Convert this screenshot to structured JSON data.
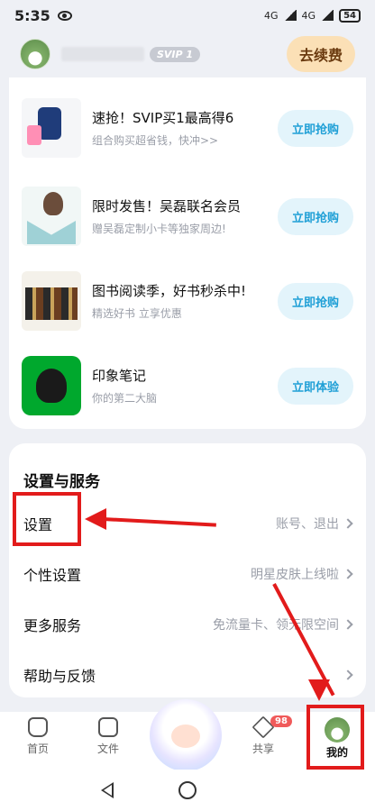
{
  "status_bar": {
    "time": "5:35",
    "battery": "54",
    "net": "4G"
  },
  "header": {
    "svip_badge": "SVIP 1",
    "renew_label": "去续费"
  },
  "promos": [
    {
      "title": "速抢！SVIP买1最高得6",
      "subtitle": "组合购买超省钱，快冲>>",
      "button": "立即抢购",
      "icon": "speaker-product-image"
    },
    {
      "title": "限时发售！吴磊联名会员",
      "subtitle": "赠吴磊定制小卡等独家周边!",
      "button": "立即抢购",
      "icon": "celebrity-card-image"
    },
    {
      "title": "图书阅读季，好书秒杀中!",
      "subtitle": "精选好书 立享优惠",
      "button": "立即抢购",
      "icon": "books-image"
    },
    {
      "title": "印象笔记",
      "subtitle": "你的第二大脑",
      "button": "立即体验",
      "icon": "evernote-icon"
    }
  ],
  "services": {
    "title": "设置与服务",
    "items": [
      {
        "label": "设置",
        "hint": "账号、退出"
      },
      {
        "label": "个性设置",
        "hint": "明星皮肤上线啦"
      },
      {
        "label": "更多服务",
        "hint": "免流量卡、领无限空间"
      },
      {
        "label": "帮助与反馈",
        "hint": ""
      }
    ]
  },
  "nav": {
    "items": [
      {
        "label": "首页"
      },
      {
        "label": "文件"
      },
      {
        "label": "共享"
      },
      {
        "label": "我的"
      }
    ],
    "share_badge": "98"
  },
  "colors": {
    "annotation": "#e21b1b",
    "accent": "#1f9fd6",
    "renew_bg": "#fbe0b6"
  }
}
